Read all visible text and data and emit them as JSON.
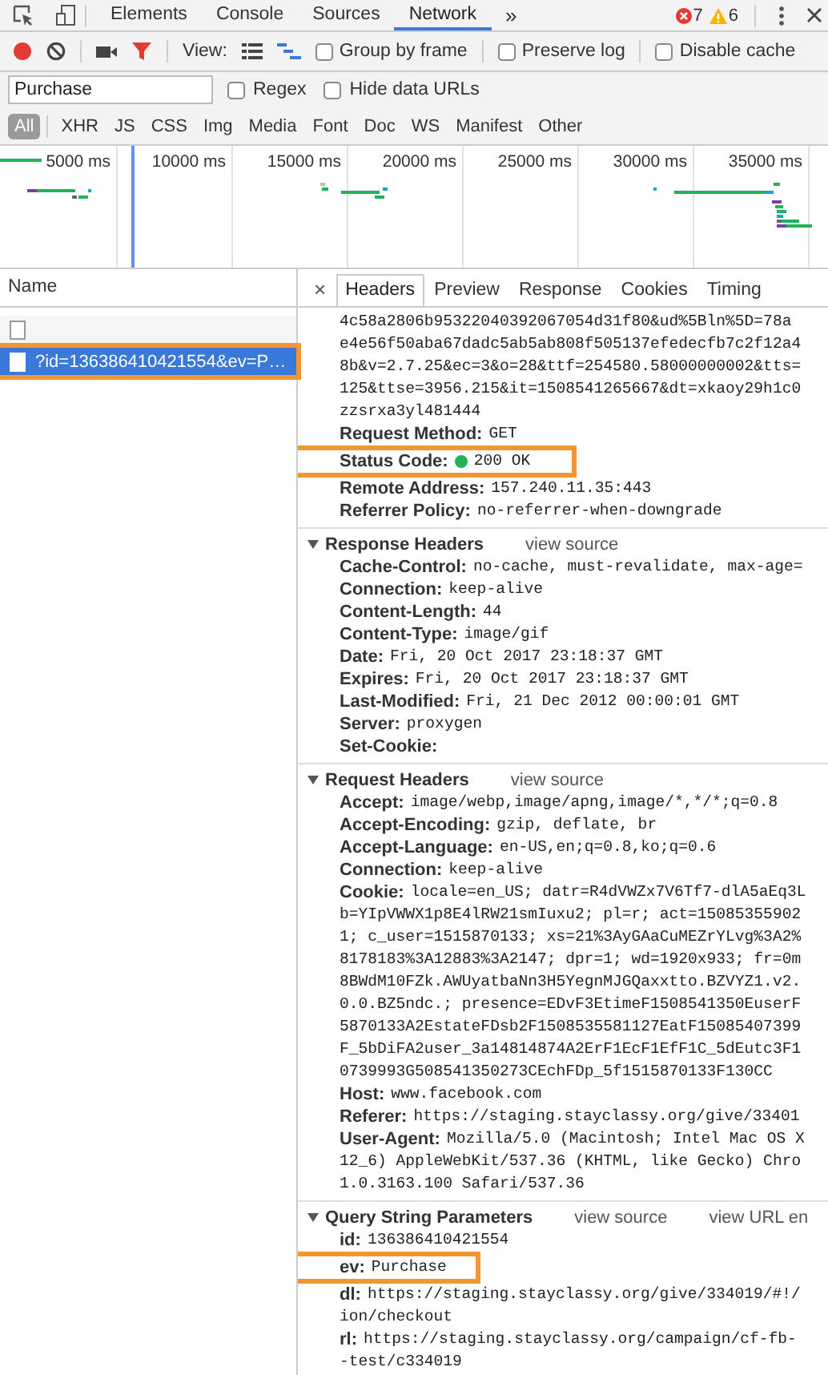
{
  "devtools_tabs": [
    {
      "label": "Elements",
      "selected": false
    },
    {
      "label": "Console",
      "selected": false
    },
    {
      "label": "Sources",
      "selected": false
    },
    {
      "label": "Network",
      "selected": true
    }
  ],
  "more_tabs": "»",
  "console_counts": {
    "errors": "7",
    "warnings": "6"
  },
  "toolbar": {
    "recording": true,
    "filter_active": true,
    "view_label": "View:",
    "views": [
      {
        "kind": "list",
        "selected": false
      },
      {
        "kind": "waterfall",
        "selected": true
      }
    ],
    "options": [
      {
        "label": "Group by frame",
        "checked": false
      },
      {
        "label": "Preserve log",
        "checked": false
      },
      {
        "label": "Disable cache",
        "checked": false
      }
    ]
  },
  "filter": {
    "value": "Purchase",
    "options": [
      {
        "label": "Regex",
        "checked": false
      },
      {
        "label": "Hide data URLs",
        "checked": false
      }
    ]
  },
  "type_filters": [
    {
      "label": "All",
      "selected": true
    },
    {
      "label": "XHR",
      "selected": false
    },
    {
      "label": "JS",
      "selected": false
    },
    {
      "label": "CSS",
      "selected": false
    },
    {
      "label": "Img",
      "selected": false
    },
    {
      "label": "Media",
      "selected": false
    },
    {
      "label": "Font",
      "selected": false
    },
    {
      "label": "Doc",
      "selected": false
    },
    {
      "label": "WS",
      "selected": false
    },
    {
      "label": "Manifest",
      "selected": false
    },
    {
      "label": "Other",
      "selected": false
    }
  ],
  "overview": {
    "ticks": [
      "5000 ms",
      "10000 ms",
      "15000 ms",
      "20000 ms",
      "25000 ms",
      "30000 ms",
      "35000 ms"
    ]
  },
  "requests": {
    "column": "Name",
    "rows": [
      {
        "selected": false,
        "highlighted": false
      },
      {
        "name": "?id=136386410421554&ev=P…",
        "selected": true,
        "highlighted": true
      }
    ]
  },
  "details": {
    "close": "×",
    "tabs": [
      {
        "label": "Headers",
        "selected": true
      },
      {
        "label": "Preview",
        "selected": false
      },
      {
        "label": "Response",
        "selected": false
      },
      {
        "label": "Cookies",
        "selected": false
      },
      {
        "label": "Timing",
        "selected": false
      }
    ],
    "url_continuation": [
      "4c58a2806b95322040392067054d31f80&ud%5Bln%5D=78a",
      "e4e56f50aba67dadc5ab5ab808f505137efedecfb7c2f12a4",
      "8b&v=2.7.25&ec=3&o=28&ttf=254580.58000000002&tts=",
      "125&ttse=3956.215&it=1508541265667&dt=xkaoy29h1c0",
      "zzsrxa3yl481444"
    ],
    "general": [
      {
        "key": "Request Method:",
        "value": "GET",
        "kind": "text",
        "highlighted": false
      },
      {
        "key": "Status Code:",
        "value": "200 OK",
        "kind": "status",
        "highlighted": true
      },
      {
        "key": "Remote Address:",
        "value": "157.240.11.35:443",
        "kind": "text",
        "highlighted": false
      },
      {
        "key": "Referrer Policy:",
        "value": "no-referrer-when-downgrade",
        "kind": "text",
        "highlighted": false
      }
    ],
    "sections": [
      {
        "title": "Response Headers",
        "expanded": true,
        "links": [
          "view source"
        ],
        "rows": [
          {
            "key": "Cache-Control:",
            "lines": [
              "no-cache, must-revalidate, max-age="
            ],
            "highlighted": false
          },
          {
            "key": "Connection:",
            "lines": [
              "keep-alive"
            ],
            "highlighted": false
          },
          {
            "key": "Content-Length:",
            "lines": [
              "44"
            ],
            "highlighted": false
          },
          {
            "key": "Content-Type:",
            "lines": [
              "image/gif"
            ],
            "highlighted": false
          },
          {
            "key": "Date:",
            "lines": [
              "Fri, 20 Oct 2017 23:18:37 GMT"
            ],
            "highlighted": false
          },
          {
            "key": "Expires:",
            "lines": [
              "Fri, 20 Oct 2017 23:18:37 GMT"
            ],
            "highlighted": false
          },
          {
            "key": "Last-Modified:",
            "lines": [
              "Fri, 21 Dec 2012 00:00:01 GMT"
            ],
            "highlighted": false
          },
          {
            "key": "Server:",
            "lines": [
              "proxygen"
            ],
            "highlighted": false
          },
          {
            "key": "Set-Cookie:",
            "lines": [],
            "highlighted": false
          }
        ]
      },
      {
        "title": "Request Headers",
        "expanded": true,
        "links": [
          "view source"
        ],
        "rows": [
          {
            "key": "Accept:",
            "lines": [
              "image/webp,image/apng,image/*,*/*;q=0.8"
            ],
            "highlighted": false
          },
          {
            "key": "Accept-Encoding:",
            "lines": [
              "gzip, deflate, br"
            ],
            "highlighted": false
          },
          {
            "key": "Accept-Language:",
            "lines": [
              "en-US,en;q=0.8,ko;q=0.6"
            ],
            "highlighted": false
          },
          {
            "key": "Connection:",
            "lines": [
              "keep-alive"
            ],
            "highlighted": false
          },
          {
            "key": "Cookie:",
            "lines": [
              "locale=en_US; datr=R4dVWZx7V6Tf7-dlA5aEq3L",
              "b=YIpVWWX1p8E4lRW21smIuxu2; pl=r; act=15085355902",
              "1; c_user=1515870133; xs=21%3AyGAaCuMEZrYLvg%3A2%",
              "8178183%3A12883%3A2147; dpr=1; wd=1920x933; fr=0m",
              "8BWdM10FZk.AWUyatbaNn3H5YegnMJGQaxxtto.BZVYZ1.v2.",
              "0.0.BZ5ndc.; presence=EDvF3EtimeF1508541350EuserF",
              "5870133A2EstateFDsb2F1508535581127EatF15085407399",
              "F_5bDiFA2user_3a14814874A2ErF1EcF1EfF1C_5dEutc3F1",
              "0739993G508541350273CEchFDp_5f1515870133F130CC"
            ],
            "highlighted": false
          },
          {
            "key": "Host:",
            "lines": [
              "www.facebook.com"
            ],
            "highlighted": false
          },
          {
            "key": "Referer:",
            "lines": [
              "https://staging.stayclassy.org/give/33401"
            ],
            "highlighted": false
          },
          {
            "key": "User-Agent:",
            "lines": [
              "Mozilla/5.0 (Macintosh; Intel Mac OS X",
              "12_6) AppleWebKit/537.36 (KHTML, like Gecko) Chro",
              "1.0.3163.100 Safari/537.36"
            ],
            "highlighted": false
          }
        ]
      },
      {
        "title": "Query String Parameters",
        "expanded": true,
        "links": [
          "view source",
          "view URL en"
        ],
        "rows": [
          {
            "key": "id:",
            "lines": [
              "136386410421554"
            ],
            "highlighted": false
          },
          {
            "key": "ev:",
            "lines": [
              "Purchase"
            ],
            "highlighted": true
          },
          {
            "key": "dl:",
            "lines": [
              "https://staging.stayclassy.org/give/334019/#!/",
              "ion/checkout"
            ],
            "highlighted": false
          },
          {
            "key": "rl:",
            "lines": [
              "https://staging.stayclassy.org/campaign/cf-fb-",
              "-test/c334019"
            ],
            "highlighted": false
          }
        ]
      }
    ]
  }
}
